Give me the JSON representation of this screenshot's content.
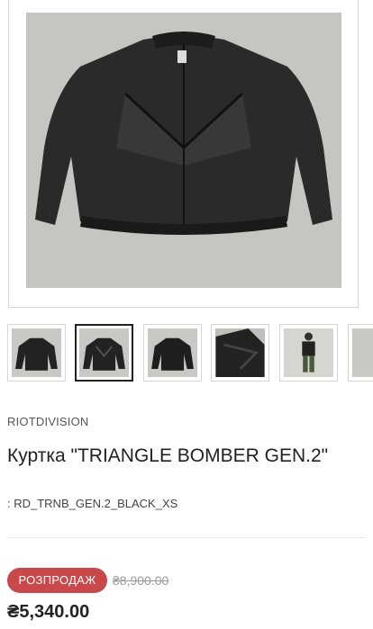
{
  "product": {
    "brand": "RIOTDIVISION",
    "title": "Куртка \"TRIANGLE BOMBER GEN.2\"",
    "sku": ": RD_TRNB_GEN.2_BLACK_XS",
    "image_subject": "black bomber jacket",
    "main_image_bg": "#c5c6c1"
  },
  "gallery": {
    "thumbnails": [
      {
        "subject": "jacket front"
      },
      {
        "subject": "jacket front with mesh (selected)"
      },
      {
        "subject": "jacket back"
      },
      {
        "subject": "jacket detail close-up"
      },
      {
        "subject": "model wearing jacket"
      },
      {
        "subject": "partial thumbnail"
      }
    ],
    "selected_index": 1
  },
  "pricing": {
    "sale_label": "РОЗПРОДАЖ",
    "old_price": "₴8,900.00",
    "new_price": "₴5,340.00",
    "sale_color": "#c9494a"
  }
}
